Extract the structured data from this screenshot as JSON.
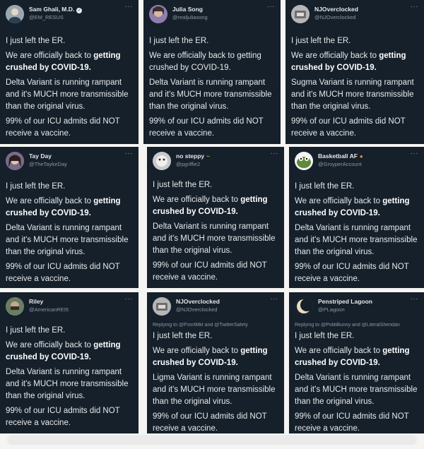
{
  "tweets": [
    {
      "name": "Sam Ghali, M.D.",
      "verified": true,
      "handle": "@EM_RESUS",
      "avatar_color": "#9aa7b0",
      "reply_to": "",
      "lines": {
        "l1": "I just left the ER.",
        "l2a": "We are officially back to ",
        "l2b": "getting crushed by COVID-19.",
        "l3": "Delta Variant is running rampant and it's MUCH more transmissible than the original virus.",
        "l4": "99% of our ICU admits did NOT receive a vaccine."
      }
    },
    {
      "name": "Julia Song",
      "verified": false,
      "handle": "@realjuliasong",
      "avatar_color": "#8e7fae",
      "reply_to": "",
      "lines": {
        "l1": "I just left the ER.",
        "l2a": "We are officially back to getting crushed by COVID-19.",
        "l2b": "",
        "l3": "Delta Variant is running rampant and it's MUCH more transmissible than the original virus.",
        "l4": "99% of our ICU admits did NOT receive a vaccine."
      }
    },
    {
      "name": "NJOverclocked",
      "verified": false,
      "handle": "@NJOverclocked",
      "avatar_color": "#b6b6b6",
      "reply_to": "",
      "lines": {
        "l1": "I just left the ER.",
        "l2a": "We are officially back to ",
        "l2b": "getting crushed by COVID-19.",
        "l3": "Sugma Variant is running rampant and it's MUCH more transmissible than the original virus.",
        "l4": "99% of our ICU admits did NOT receive a vaccine."
      }
    },
    {
      "name": "Tay Day",
      "verified": false,
      "handle": "@TheTaylorDay",
      "avatar_color": "#7b6a88",
      "reply_to": "",
      "lines": {
        "l1": "I just left the ER.",
        "l2a": "We are officially back to ",
        "l2b": "getting crushed by COVID-19.",
        "l3": "Delta Variant is running rampant and it's MUCH more transmissible than the original virus.",
        "l4": "99% of our ICU admits did NOT receive a vaccine."
      }
    },
    {
      "name": "no steppy",
      "verified": false,
      "handle": "@pgriffie2",
      "avatar_color": "#c9c9c9",
      "reply_to": "",
      "lines": {
        "l1": "I just left the ER.",
        "l2a": "We are officially back to ",
        "l2b": "getting crushed by COVID-19.",
        "l3": "Delta Variant is running rampant and it's MUCH more transmissible than the original virus.",
        "l4": "99% of our ICU admits did NOT receive a vaccine."
      }
    },
    {
      "name": "Basketball AF",
      "verified": false,
      "handle": "@GroyperAccount",
      "avatar_color": "#5f8a3c",
      "reply_to": "",
      "lines": {
        "l1": "I just left the ER.",
        "l2a": "We are officially back to ",
        "l2b": "getting crushed by COVID-19.",
        "l3": "Delta Variant is running rampant and it's MUCH more transmissible than the original virus.",
        "l4": "99% of our ICU admits did NOT receive a vaccine."
      }
    },
    {
      "name": "Riley",
      "verified": false,
      "handle": "@AmericanREI5",
      "avatar_color": "#6b7d63",
      "reply_to": "",
      "lines": {
        "l1": "I just left the ER.",
        "l2a": "We are officially back to ",
        "l2b": "getting crushed by COVID-19.",
        "l3": "Delta Variant is running rampant and it's MUCH more transmissible than the original virus.",
        "l4": "99% of our ICU admits did NOT receive a vaccine."
      }
    },
    {
      "name": "NJOverclocked",
      "verified": false,
      "handle": "@NJOverclocked",
      "avatar_color": "#b6b6b6",
      "reply_to": "Replying to @FrontMkt and @TwitterSafety",
      "lines": {
        "l1": "I just left the ER.",
        "l2a": "We are officially back to ",
        "l2b": "getting crushed by COVID-19.",
        "l3": "Ligma Variant is running rampant and it's MUCH more transmissible than the original virus.",
        "l4": "99% of our ICU admits did NOT receive a vaccine."
      }
    },
    {
      "name": "Penstriped Lagoon",
      "verified": false,
      "handle": "@PLagoon",
      "avatar_color": "#d8c9a8",
      "reply_to": "Replying to @PolitiBunny and @LiteralSheridan",
      "lines": {
        "l1": "I just left the ER.",
        "l2a": "We are officially back to ",
        "l2b": "getting crushed by COVID-19.",
        "l3": "Delta Variant is running rampant and it's MUCH more transmissible than the original virus.",
        "l4": "99% of our ICU admits did NOT receive a vaccine."
      }
    }
  ]
}
